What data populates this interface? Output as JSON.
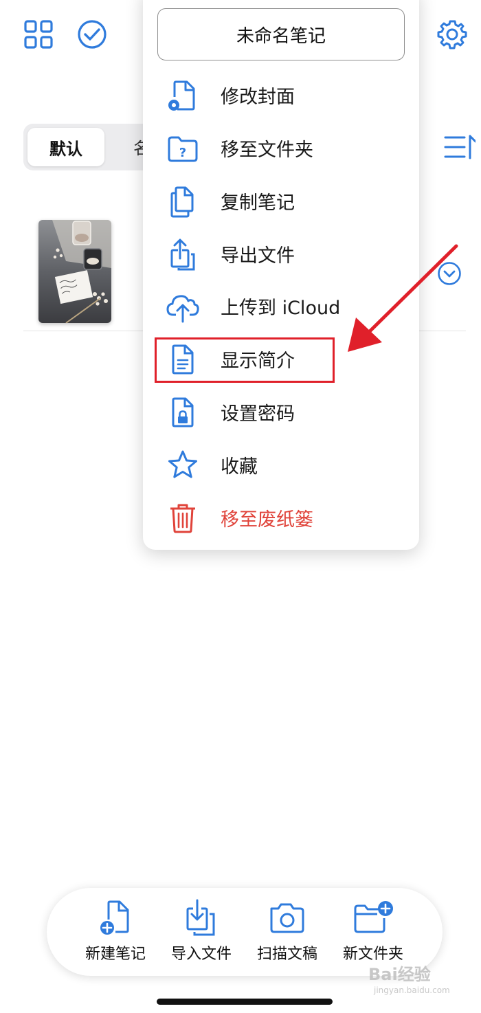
{
  "header": {
    "left_icons": [
      "grid-icon",
      "checkmark-circle-icon"
    ],
    "right_icon": "gear-icon"
  },
  "sort_tabs": {
    "active": "默认",
    "next_partial": "名"
  },
  "menu": {
    "title": "未命名笔记",
    "items": [
      {
        "label": "修改封面",
        "icon": "file-gear-icon"
      },
      {
        "label": "移至文件夹",
        "icon": "folder-question-icon"
      },
      {
        "label": "复制笔记",
        "icon": "copy-icon"
      },
      {
        "label": "导出文件",
        "icon": "share-icon"
      },
      {
        "label": "上传到 iCloud",
        "icon": "cloud-upload-icon"
      },
      {
        "label": "显示简介",
        "icon": "document-icon"
      },
      {
        "label": "设置密码",
        "icon": "file-lock-icon"
      },
      {
        "label": "收藏",
        "icon": "star-icon"
      },
      {
        "label": "移至废纸篓",
        "icon": "trash-icon"
      }
    ],
    "highlighted_item": "显示简介"
  },
  "toolbar": {
    "items": [
      {
        "label": "新建笔记",
        "icon": "new-note-icon"
      },
      {
        "label": "导入文件",
        "icon": "import-icon"
      },
      {
        "label": "扫描文稿",
        "icon": "camera-icon"
      },
      {
        "label": "新文件夹",
        "icon": "new-folder-icon"
      }
    ]
  },
  "watermark": {
    "brand": "Bai经验",
    "url": "jingyan.baidu.com"
  },
  "colors": {
    "accent": "#2f7bdc",
    "danger": "#e0433a",
    "annotation": "#e0202a"
  }
}
